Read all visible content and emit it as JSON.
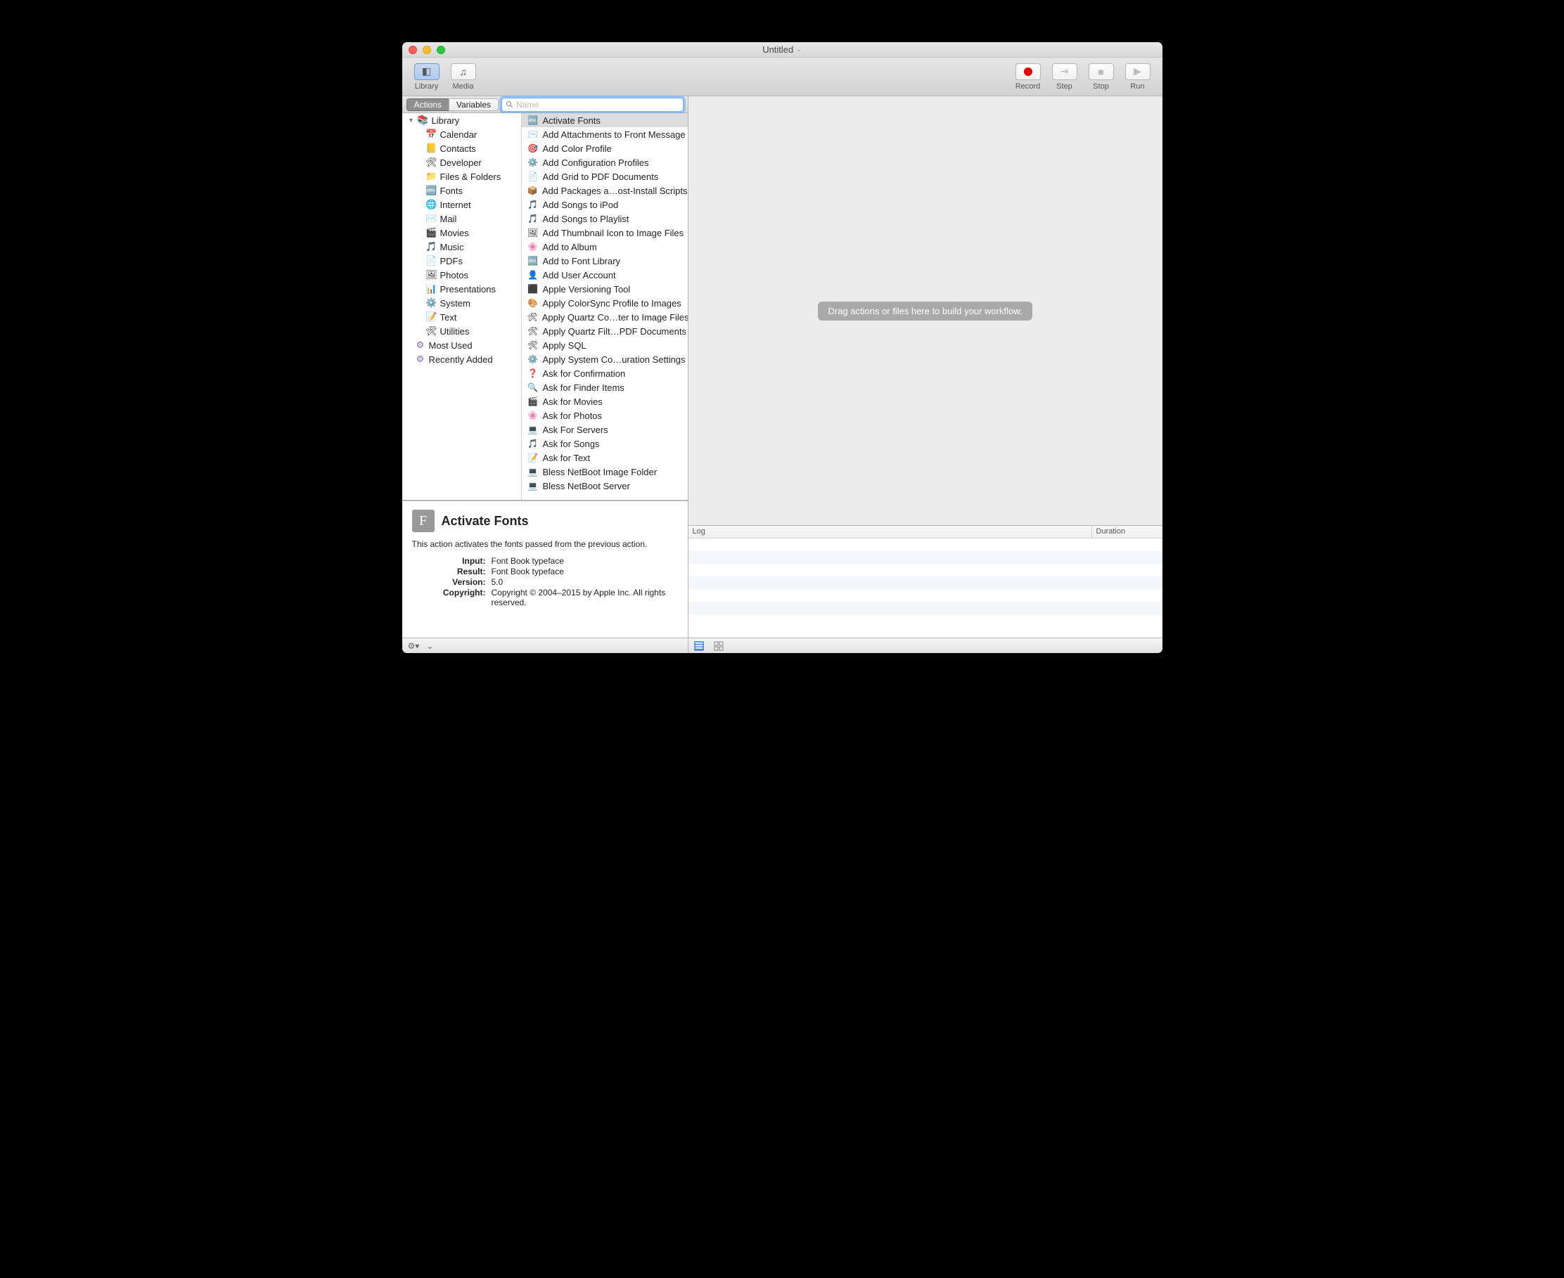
{
  "window": {
    "title": "Untitled"
  },
  "toolbar": {
    "library": "Library",
    "media": "Media",
    "record": "Record",
    "step": "Step",
    "stop": "Stop",
    "run": "Run"
  },
  "tabs": {
    "actions": "Actions",
    "variables": "Variables"
  },
  "search": {
    "placeholder": "Name"
  },
  "library": {
    "root": "Library",
    "categories": [
      {
        "label": "Calendar",
        "icon": "📅"
      },
      {
        "label": "Contacts",
        "icon": "📒"
      },
      {
        "label": "Developer",
        "icon": "🛠"
      },
      {
        "label": "Files & Folders",
        "icon": "📁"
      },
      {
        "label": "Fonts",
        "icon": "🔤"
      },
      {
        "label": "Internet",
        "icon": "🌐"
      },
      {
        "label": "Mail",
        "icon": "✉️"
      },
      {
        "label": "Movies",
        "icon": "🎬"
      },
      {
        "label": "Music",
        "icon": "🎵"
      },
      {
        "label": "PDFs",
        "icon": "📄"
      },
      {
        "label": "Photos",
        "icon": "🖼"
      },
      {
        "label": "Presentations",
        "icon": "📊"
      },
      {
        "label": "System",
        "icon": "⚙️"
      },
      {
        "label": "Text",
        "icon": "📝"
      },
      {
        "label": "Utilities",
        "icon": "🛠"
      }
    ],
    "smart": [
      {
        "label": "Most Used",
        "icon": "⚙︎"
      },
      {
        "label": "Recently Added",
        "icon": "⚙︎"
      }
    ]
  },
  "actions": [
    {
      "label": "Activate Fonts",
      "icon": "🔤",
      "selected": true
    },
    {
      "label": "Add Attachments to Front Message",
      "icon": "✉️"
    },
    {
      "label": "Add Color Profile",
      "icon": "🎯"
    },
    {
      "label": "Add Configuration Profiles",
      "icon": "⚙️"
    },
    {
      "label": "Add Grid to PDF Documents",
      "icon": "📄"
    },
    {
      "label": "Add Packages a…ost-Install Scripts",
      "icon": "📦"
    },
    {
      "label": "Add Songs to iPod",
      "icon": "🎵"
    },
    {
      "label": "Add Songs to Playlist",
      "icon": "🎵"
    },
    {
      "label": "Add Thumbnail Icon to Image Files",
      "icon": "🖼"
    },
    {
      "label": "Add to Album",
      "icon": "🌸"
    },
    {
      "label": "Add to Font Library",
      "icon": "🔤"
    },
    {
      "label": "Add User Account",
      "icon": "👤"
    },
    {
      "label": "Apple Versioning Tool",
      "icon": "⬛"
    },
    {
      "label": "Apply ColorSync Profile to Images",
      "icon": "🎨"
    },
    {
      "label": "Apply Quartz Co…ter to Image Files",
      "icon": "🛠"
    },
    {
      "label": "Apply Quartz Filt…PDF Documents",
      "icon": "🛠"
    },
    {
      "label": "Apply SQL",
      "icon": "🛠"
    },
    {
      "label": "Apply System Co…uration Settings",
      "icon": "⚙️"
    },
    {
      "label": "Ask for Confirmation",
      "icon": "❓"
    },
    {
      "label": "Ask for Finder Items",
      "icon": "🔍"
    },
    {
      "label": "Ask for Movies",
      "icon": "🎬"
    },
    {
      "label": "Ask for Photos",
      "icon": "🌸"
    },
    {
      "label": "Ask For Servers",
      "icon": "💻"
    },
    {
      "label": "Ask for Songs",
      "icon": "🎵"
    },
    {
      "label": "Ask for Text",
      "icon": "📝"
    },
    {
      "label": "Bless NetBoot Image Folder",
      "icon": "💻"
    },
    {
      "label": "Bless NetBoot Server",
      "icon": "💻"
    }
  ],
  "info": {
    "title": "Activate Fonts",
    "desc": "This action activates the fonts passed from the previous action.",
    "input_k": "Input:",
    "input_v": "Font Book typeface",
    "result_k": "Result:",
    "result_v": "Font Book typeface",
    "version_k": "Version:",
    "version_v": "5.0",
    "copyright_k": "Copyright:",
    "copyright_v": "Copyright © 2004–2015 by Apple Inc. All rights reserved."
  },
  "canvas": {
    "hint": "Drag actions or files here to build your workflow."
  },
  "log": {
    "log_col": "Log",
    "dur_col": "Duration"
  }
}
